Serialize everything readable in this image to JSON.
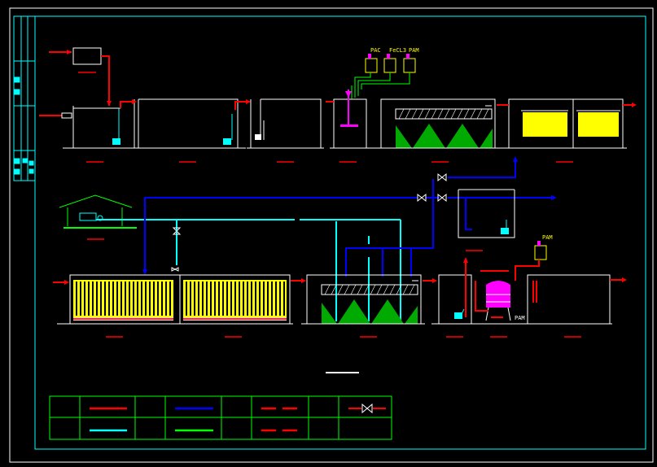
{
  "chem_labels": {
    "pac": "PAC",
    "fecl3": "FeCL3",
    "pam": "PAM"
  },
  "right_chem_label": "PAM",
  "dosing_label": "PAM",
  "colors": {
    "background": "#000000",
    "frame": "#00ffff",
    "tank_outline": "#ffffff",
    "sewage_pipe": "#ff0000",
    "air_pipe": "#0000ff",
    "reuse_pipe": "#00ffff",
    "chem_pipe": "#00ff00",
    "media": "#ffff00",
    "sludge": "#00aa00",
    "caption_underline": "#ff0000"
  },
  "legend": {
    "rows": [
      {
        "line_color": "#ff0000",
        "dashed": false
      },
      {
        "line_color": "#0000ff",
        "dashed": false
      },
      {
        "line_color": "#ff0000",
        "dashed": true
      },
      {
        "line_color": "#ff0000",
        "valve": true
      },
      {
        "line_color": "#00ffff",
        "dashed": false
      },
      {
        "line_color": "#00ff00",
        "dashed": false
      },
      {
        "line_color": "#ff0000",
        "dashed": true
      }
    ]
  }
}
